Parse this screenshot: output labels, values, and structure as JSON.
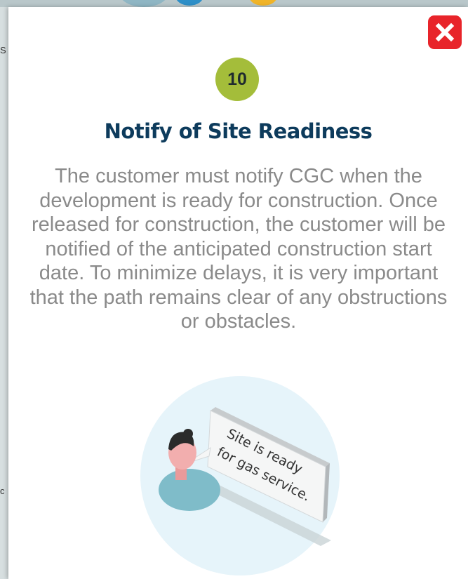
{
  "background": {
    "letters": [
      "S",
      "c"
    ]
  },
  "modal": {
    "close_icon": "close-icon",
    "step_number": "10",
    "title": "Notify of Site Readiness",
    "body": "The customer must notify CGC when the development is ready for construction. Once released for construction, the customer will be notified of the anticipated construction start date. To minimize delays, it is very important that the path remains clear of any obstructions or obstacles.",
    "illustration": {
      "speech_line_1": "Site is ready",
      "speech_line_2": "for gas service."
    }
  },
  "colors": {
    "close": "#e8242a",
    "badge": "#a4bd3a",
    "title": "#0d3b5c",
    "body": "#8a8a8a",
    "circle": "#e6f4fa"
  }
}
